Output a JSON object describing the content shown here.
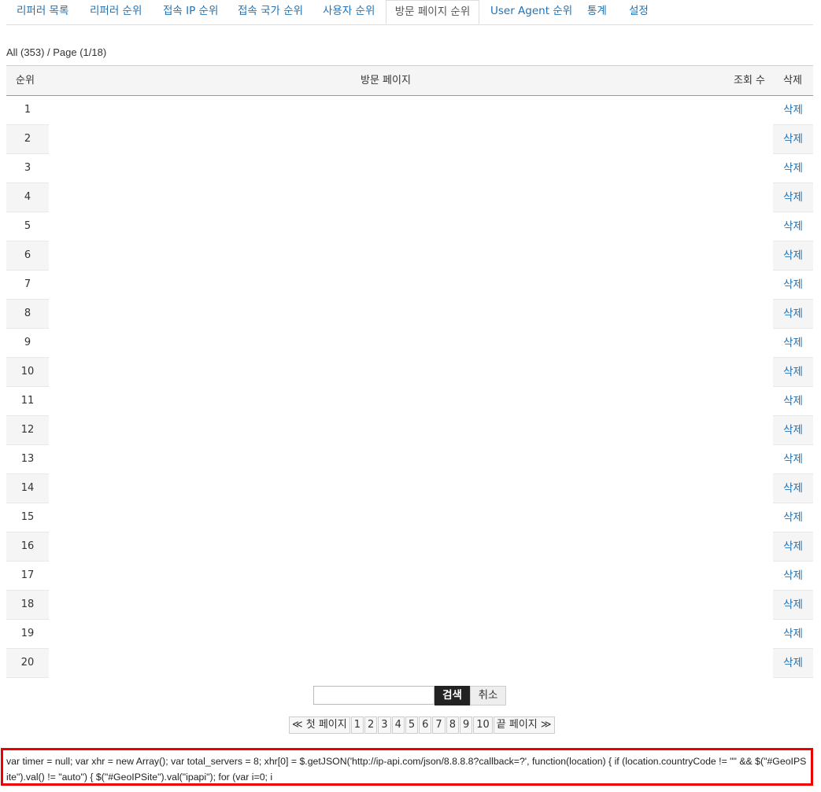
{
  "tabs": [
    {
      "label": "리퍼러 목록",
      "active": false
    },
    {
      "label": "리퍼러 순위",
      "active": false
    },
    {
      "label": "접속 IP 순위",
      "active": false
    },
    {
      "label": "접속 국가 순위",
      "active": false
    },
    {
      "label": "사용자 순위",
      "active": false
    },
    {
      "label": "방문 페이지 순위",
      "active": true
    },
    {
      "label": "User Agent 순위",
      "active": false
    },
    {
      "label": "통계",
      "active": false
    },
    {
      "label": "설정",
      "active": false
    }
  ],
  "summary": "All (353) / Page (1/18)",
  "table": {
    "headers": {
      "rank": "순위",
      "page": "방문 페이지",
      "views": "조회 수",
      "delete": "삭제"
    },
    "rows": [
      {
        "rank": "1",
        "delete": "삭제"
      },
      {
        "rank": "2",
        "delete": "삭제"
      },
      {
        "rank": "3",
        "delete": "삭제"
      },
      {
        "rank": "4",
        "delete": "삭제"
      },
      {
        "rank": "5",
        "delete": "삭제"
      },
      {
        "rank": "6",
        "delete": "삭제"
      },
      {
        "rank": "7",
        "delete": "삭제"
      },
      {
        "rank": "8",
        "delete": "삭제"
      },
      {
        "rank": "9",
        "delete": "삭제"
      },
      {
        "rank": "10",
        "delete": "삭제"
      },
      {
        "rank": "11",
        "delete": "삭제"
      },
      {
        "rank": "12",
        "delete": "삭제"
      },
      {
        "rank": "13",
        "delete": "삭제"
      },
      {
        "rank": "14",
        "delete": "삭제"
      },
      {
        "rank": "15",
        "delete": "삭제"
      },
      {
        "rank": "16",
        "delete": "삭제"
      },
      {
        "rank": "17",
        "delete": "삭제"
      },
      {
        "rank": "18",
        "delete": "삭제"
      },
      {
        "rank": "19",
        "delete": "삭제"
      },
      {
        "rank": "20",
        "delete": "삭제"
      }
    ]
  },
  "search": {
    "placeholder": "",
    "value": "",
    "search_label": "검색",
    "cancel_label": "취소"
  },
  "pagination": {
    "first": "≪ 첫 페이지",
    "pages": [
      "1",
      "2",
      "3",
      "4",
      "5",
      "6",
      "7",
      "8",
      "9",
      "10"
    ],
    "last": "끝 페이지 ≫"
  },
  "code_text": "var timer = null; var xhr = new Array(); var total_servers = 8; xhr[0] = $.getJSON('http://ip-api.com/json/8.8.8.8?callback=?', function(location) { if (location.countryCode != \"\" && $(\"#GeoIPSite\").val() != \"auto\") { $(\"#GeoIPSite\").val(\"ipapi\"); for (var i=0; i"
}
